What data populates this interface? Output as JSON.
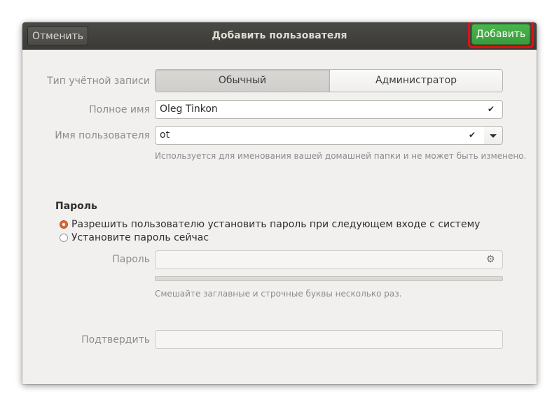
{
  "header": {
    "title": "Добавить пользователя",
    "cancel_label": "Отменить",
    "add_label": "Добавить"
  },
  "account_type": {
    "label": "Тип учётной записи",
    "options": [
      "Обычный",
      "Администратор"
    ],
    "selected": "Обычный"
  },
  "full_name": {
    "label": "Полное имя",
    "value": "Oleg Tinkon",
    "valid_icon": "checkmark-icon"
  },
  "username": {
    "label": "Имя пользователя",
    "value": "ot",
    "valid_icon": "checkmark-icon",
    "hint": "Используется для именования вашей домашней папки и не может быть изменено."
  },
  "password_section": {
    "title": "Пароль",
    "options": [
      "Разрешить пользователю установить пароль при следующем входе с систему",
      "Установите пароль сейчас"
    ],
    "selected_index": 0,
    "password_label": "Пароль",
    "password_value": "",
    "generate_icon": "gear-icon",
    "strength_level": 0,
    "strength_hint": "Смешайте заглавные и строчные буквы несколько раз.",
    "confirm_label": "Подтвердить",
    "confirm_value": ""
  }
}
